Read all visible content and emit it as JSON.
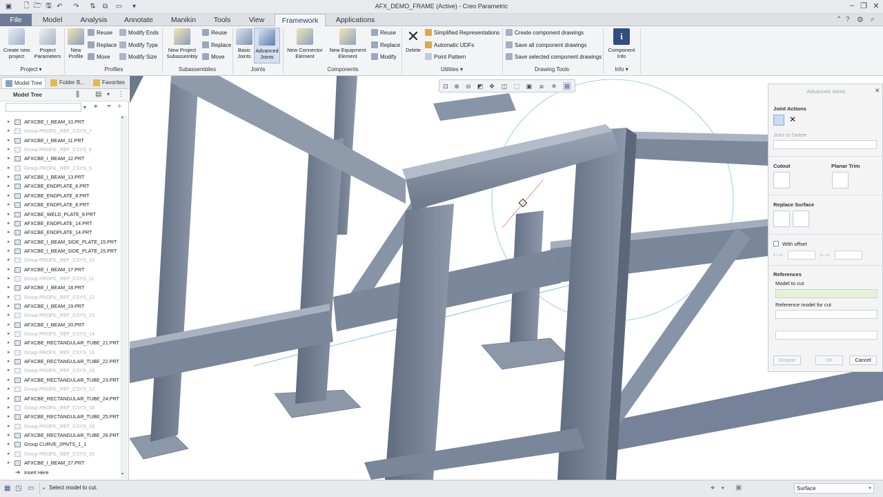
{
  "window": {
    "title": "AFX_DEMO_FRAME (Active) - Creo Parametric"
  },
  "tabs": [
    {
      "label": "File"
    },
    {
      "label": "Model"
    },
    {
      "label": "Analysis"
    },
    {
      "label": "Annotate"
    },
    {
      "label": "Manikin"
    },
    {
      "label": "Tools"
    },
    {
      "label": "View"
    },
    {
      "label": "Framework"
    },
    {
      "label": "Applications"
    }
  ],
  "ribbon": {
    "project": {
      "create_new_project": "Create new\nproject",
      "project_parameters": "Project\nParameters",
      "label": "Project ▾"
    },
    "profiles": {
      "new_profile": "New\nProfile",
      "reuse": "Reuse",
      "replace": "Replace",
      "move": "Move",
      "modify_ends": "Modify Ends",
      "modify_type": "Modify Type",
      "modify_size": "Modify Size",
      "label": "Profiles"
    },
    "subassemblies": {
      "new_project_subassembly": "New Project\nSubassembly",
      "reuse": "Reuse",
      "replace": "Replace",
      "move": "Move",
      "label": "Subassemblies"
    },
    "joints": {
      "basic_joints": "Basic\nJoints",
      "advanced_joints": "Advanced\nJoints",
      "label": "Joints"
    },
    "components": {
      "new_connector_element": "New Connector\nElement",
      "new_equipment_element": "New Equipment\nElement",
      "reuse": "Reuse",
      "replace": "Replace",
      "modify": "Modify",
      "label": "Components"
    },
    "utilities": {
      "delete": "Delete",
      "simplified_representations": "Simplified Representations",
      "automatic_udfs": "Automatic UDFs",
      "point_pattern": "Point Pattern",
      "label": "Utilities ▾"
    },
    "drawing_tools": {
      "create_component_drawings": "Create component drawings",
      "save_all_component_drawings": "Save all component drawings",
      "save_selected_component_drawings": "Save selected component drawings",
      "label": "Drawing Tools"
    },
    "info": {
      "component_info": "Component\nInfo",
      "label": "Info ▾"
    }
  },
  "panel": {
    "tabs": [
      "Model Tree",
      "Folder B...",
      "Favorites"
    ],
    "header": "Model Tree",
    "items": [
      {
        "label": "AFXCBE_I_BEAM_10.PRT",
        "dim": false
      },
      {
        "label": "Group PROFIL_REF_CSYS_7",
        "dim": true
      },
      {
        "label": "AFXCBE_I_BEAM_11.PRT",
        "dim": false
      },
      {
        "label": "Group PROFIL_REF_CSYS_8",
        "dim": true
      },
      {
        "label": "AFXCBE_I_BEAM_12.PRT",
        "dim": false
      },
      {
        "label": "Group PROFIL_REF_CSYS_9",
        "dim": true
      },
      {
        "label": "AFXCBE_I_BEAM_13.PRT",
        "dim": false
      },
      {
        "label": "AFXCBE_ENDPLATE_8.PRT",
        "dim": false
      },
      {
        "label": "AFXCBE_ENDPLATE_8.PRT",
        "dim": false
      },
      {
        "label": "AFXCBE_ENDPLATE_8.PRT",
        "dim": false
      },
      {
        "label": "AFXCBE_WELD_PLATE_9.PRT",
        "dim": false
      },
      {
        "label": "AFXCBE_ENDPLATE_14.PRT",
        "dim": false
      },
      {
        "label": "AFXCBE_ENDPLATE_14.PRT",
        "dim": false
      },
      {
        "label": "AFXCBE_I_BEAM_SIDE_PLATE_15.PRT",
        "dim": false
      },
      {
        "label": "AFXCBE_I_BEAM_SIDE_PLATE_15.PRT",
        "dim": false
      },
      {
        "label": "Group PROFIL_REF_CSYS_10",
        "dim": true
      },
      {
        "label": "AFXCBE_I_BEAM_17.PRT",
        "dim": false
      },
      {
        "label": "Group PROFIL_REF_CSYS_11",
        "dim": true
      },
      {
        "label": "AFXCBE_I_BEAM_18.PRT",
        "dim": false
      },
      {
        "label": "Group PROFIL_REF_CSYS_12",
        "dim": true
      },
      {
        "label": "AFXCBE_I_BEAM_19.PRT",
        "dim": false
      },
      {
        "label": "Group PROFIL_REF_CSYS_13",
        "dim": true
      },
      {
        "label": "AFXCBE_I_BEAM_20.PRT",
        "dim": false
      },
      {
        "label": "Group PROFIL_REF_CSYS_14",
        "dim": true
      },
      {
        "label": "AFXCBE_RECTANGULAR_TUBE_21.PRT",
        "dim": false
      },
      {
        "label": "Group PROFIL_REF_CSYS_15",
        "dim": true
      },
      {
        "label": "AFXCBE_RECTANGULAR_TUBE_22.PRT",
        "dim": false
      },
      {
        "label": "Group PROFIL_REF_CSYS_16",
        "dim": true
      },
      {
        "label": "AFXCBE_RECTANGULAR_TUBE_23.PRT",
        "dim": false
      },
      {
        "label": "Group PROFIL_REF_CSYS_17",
        "dim": true
      },
      {
        "label": "AFXCBE_RECTANGULAR_TUBE_24.PRT",
        "dim": false
      },
      {
        "label": "Group PROFIL_REF_CSYS_18",
        "dim": true
      },
      {
        "label": "AFXCBE_RECTANGULAR_TUBE_25.PRT",
        "dim": false
      },
      {
        "label": "Group PROFIL_REF_CSYS_19",
        "dim": true
      },
      {
        "label": "AFXCBE_RECTANGULAR_TUBE_26.PRT",
        "dim": false
      },
      {
        "label": "Group CURVE_2PNTS_1_1",
        "dim": false
      },
      {
        "label": "Group PROFIL_REF_CSYS_20",
        "dim": true
      },
      {
        "label": "AFXCBE_I_BEAM_27.PRT",
        "dim": false
      }
    ],
    "insert_here": "Insert Here"
  },
  "dialog": {
    "title": "Advanced Joints",
    "joint_actions": "Joint Actions",
    "joint_to_delete": "Joint to Delete",
    "cutout": "Cutout",
    "planar_trim": "Planar Trim",
    "replace_surface": "Replace Surface",
    "with_offset": "With offset",
    "references": "References",
    "model_to_cut": "Model to cut",
    "reference_model_for_cut": "Reference model for cut",
    "dash": "-",
    "buttons": {
      "repeat": "Repeat",
      "ok": "OK",
      "cancel": "Cancel"
    }
  },
  "status": {
    "message": "Select model to cut.",
    "filter": "Surface"
  },
  "colors": {
    "file_tab": "#6d7c94",
    "steel": "#7c879a",
    "highlight": "#e6f2d8",
    "axis": "#59b6e0"
  }
}
